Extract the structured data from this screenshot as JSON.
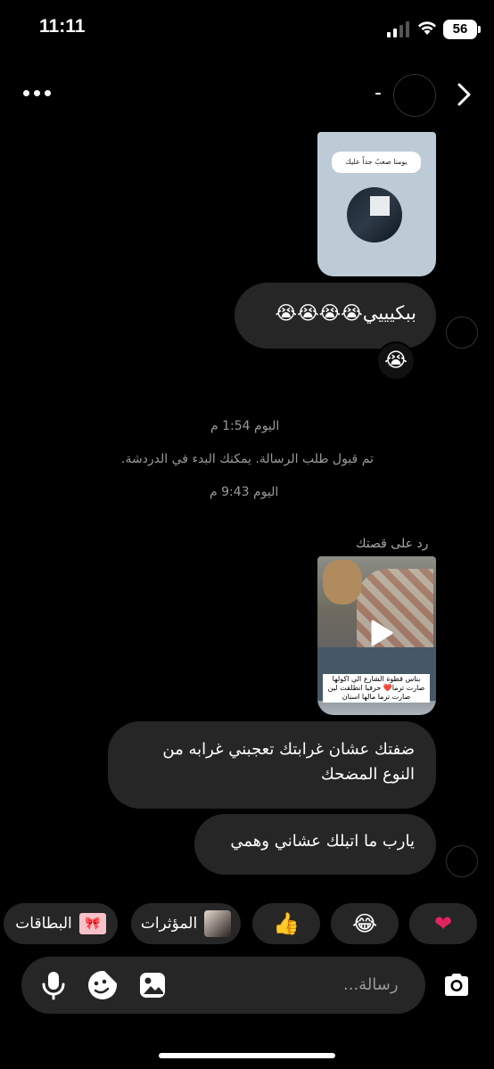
{
  "status_bar": {
    "time": "11:11",
    "battery": "56"
  },
  "header": {
    "name": "-",
    "more_icon": "more-horizontal-icon",
    "back_icon": "chevron-right-icon"
  },
  "story1": {
    "text": "يومنا صعبً جداً عليك"
  },
  "messages": [
    {
      "text": "ببكيييي😭😭😭😭",
      "reaction": "😭"
    },
    {
      "text": "ضفتك عشان غرابتك تعجبني غرابه من النوع المضحك"
    },
    {
      "text": "يارب ما اتبلك عشاني وهمي"
    }
  ],
  "system": {
    "time1": "اليوم 1:54 م",
    "accepted": "تم قبول طلب الرسالة. يمكنك البدء في الدردشة.",
    "time2": "اليوم 9:43 م",
    "reply_label": "رد على قصتك"
  },
  "story2": {
    "caption": "بناس قطوة الشارع الي اكولها صارت ترما❤️ حرفيا انطلقت لين صارت ترما مالها اسنان"
  },
  "quick_reactions": {
    "cards_label": "البطاقات",
    "effects_label": "المؤثرات",
    "thumbs": "👍",
    "laugh": "😂",
    "heart": "❤"
  },
  "composer": {
    "placeholder": "رسالة..."
  }
}
